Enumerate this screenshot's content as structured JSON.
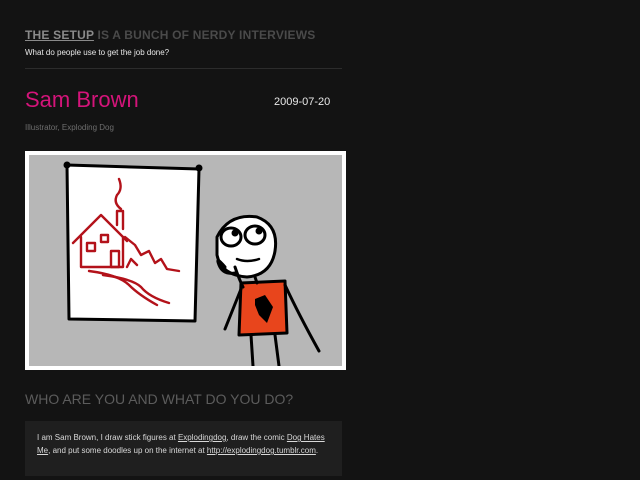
{
  "header": {
    "brand": "THE SETUP",
    "title_rest": " IS A BUNCH OF NERDY INTERVIEWS",
    "tagline": "What do people use to get the job done?"
  },
  "interview": {
    "name": "Sam Brown",
    "date": "2009-07-20",
    "role": "Illustrator, Exploding Dog"
  },
  "section": {
    "heading": "WHO ARE YOU AND WHAT DO YOU DO?",
    "answer": {
      "t1": "I am Sam Brown, I draw stick figures at ",
      "link1": "Explodingdog",
      "t2": ", draw the comic ",
      "link2": "Dog Hates Me",
      "t3": ", and put some doodles up on the internet at ",
      "link3": "http://explodingdog.tumblr.com",
      "t4": "."
    }
  },
  "colors": {
    "background": "#131313",
    "name_accent": "#d4147a",
    "drawing_red": "#b3121a",
    "shirt": "#e8451c"
  }
}
